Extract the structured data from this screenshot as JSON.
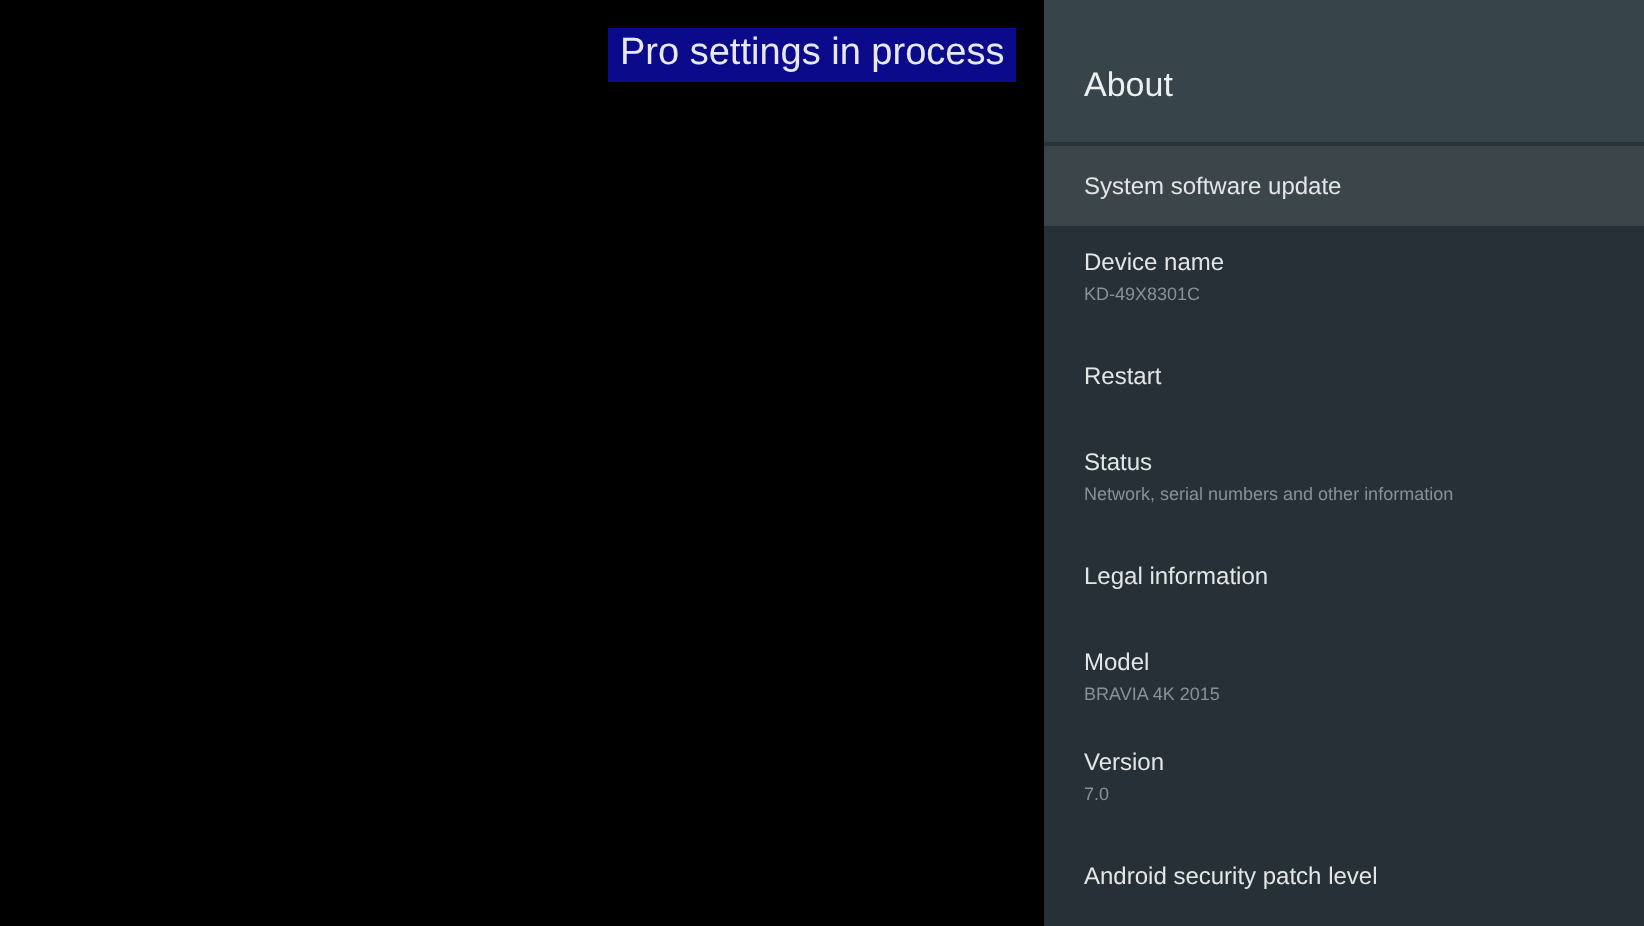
{
  "banner": {
    "text": "Pro settings in process"
  },
  "panel": {
    "title": "About",
    "items": [
      {
        "title": "System software update",
        "selected": true
      },
      {
        "title": "Device name",
        "summary": "KD-49X8301C",
        "selected": false
      },
      {
        "title": "Restart",
        "selected": false
      },
      {
        "title": "Status",
        "summary": "Network, serial numbers and other information",
        "selected": false
      },
      {
        "title": "Legal information",
        "selected": false
      },
      {
        "title": "Model",
        "summary": "BRAVIA 4K 2015",
        "selected": false
      },
      {
        "title": "Version",
        "summary": "7.0",
        "selected": false
      },
      {
        "title": "Android security patch level",
        "selected": false
      }
    ]
  }
}
